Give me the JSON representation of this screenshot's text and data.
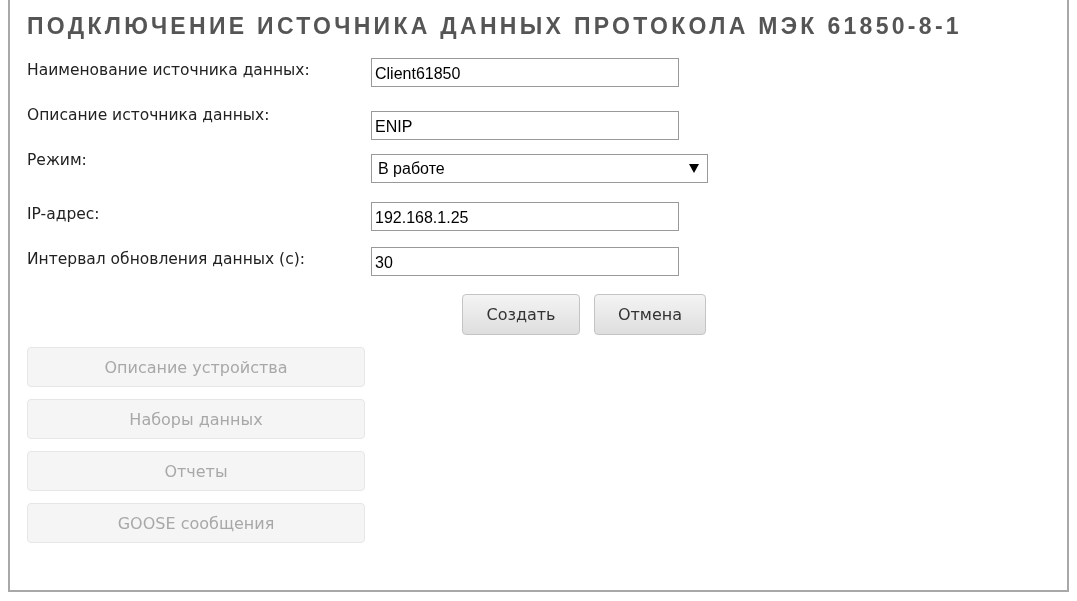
{
  "title": "ПОДКЛЮЧЕНИЕ ИСТОЧНИКА ДАННЫХ ПРОТОКОЛА МЭК 61850-8-1",
  "fields": [
    {
      "kind": "text",
      "label": "Наименование источника данных:",
      "value": "Client61850"
    },
    {
      "kind": "text",
      "label": "Описание источника данных:",
      "value": "ENIP"
    },
    {
      "kind": "select",
      "label": "Режим:",
      "value": "В работе"
    },
    {
      "kind": "text",
      "label": "IP-адрес:",
      "value": "192.168.1.25"
    },
    {
      "kind": "text",
      "label": "Интервал обновления данных (с):",
      "value": "30"
    }
  ],
  "actions": [
    "Создать",
    "Отмена"
  ],
  "sections": [
    {
      "label": "Описание устройства",
      "disabled": true
    },
    {
      "label": "Наборы данных",
      "disabled": true
    },
    {
      "label": "Отчеты",
      "disabled": true
    },
    {
      "label": "GOOSE сообщения",
      "disabled": true
    }
  ]
}
